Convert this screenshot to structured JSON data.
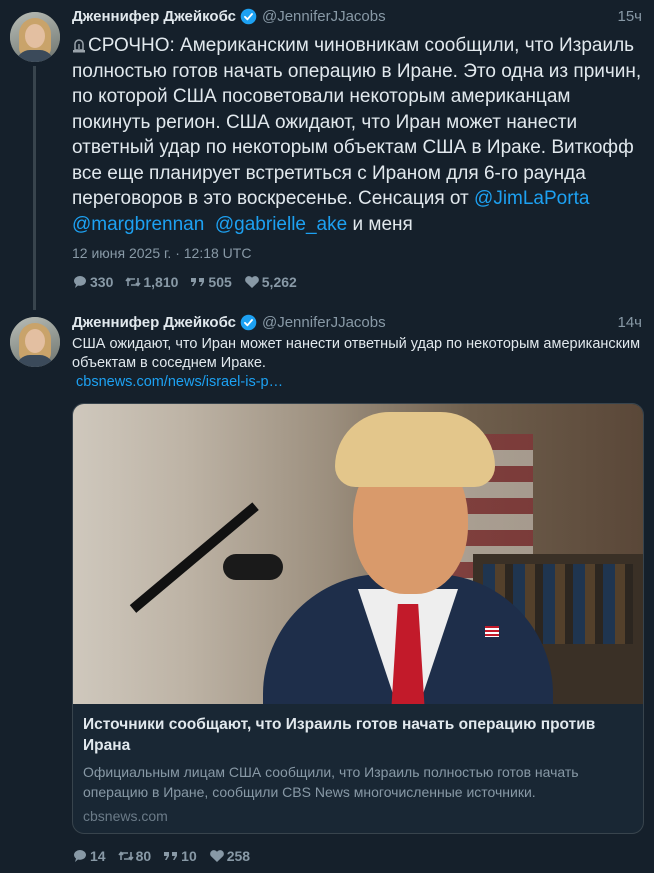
{
  "tweets": [
    {
      "author_name": "Дженнифер Джейкобс",
      "handle": "@JenniferJJacobs",
      "time": "15ч",
      "text_main": "СРОЧНО: Американским чиновникам сообщили, что Израиль полностью готов начать операцию в Иране. Это одна из причин, по которой США посоветовали некоторым американцам покинуть регион. США ожидают, что Иран может нанести ответный удар по некоторым объектам США в Ираке. Виткофф все еще планирует встретиться с Ираном для 6-го раунда переговоров в это воскресенье. Сенсация от",
      "mentions": [
        "@JimLaPorta",
        "@margbrennan",
        "@gabrielle_ake"
      ],
      "text_tail": "и меня",
      "date": "12 июня 2025 г. · 12:18 UTC",
      "stats": {
        "replies": "330",
        "retweets": "1,810",
        "quotes": "505",
        "likes": "5,262"
      }
    },
    {
      "author_name": "Дженнифер Джейкобс",
      "handle": "@JenniferJJacobs",
      "time": "14ч",
      "text_main": "США ожидают, что Иран может нанести ответный удар по некоторым американским объектам в соседнем Ираке.",
      "link": "cbsnews.com/news/israel-is-p…",
      "card": {
        "title": "Источники сообщают, что Израиль готов начать операцию против Ирана",
        "description": "Официальным лицам США сообщили, что Израиль полностью готов начать операцию в Иране, сообщили CBS News многочисленные источники.",
        "domain": "cbsnews.com"
      },
      "stats": {
        "replies": "14",
        "retweets": "80",
        "quotes": "10",
        "likes": "258"
      }
    }
  ],
  "icons": [
    "verified-badge-icon",
    "alarm-icon",
    "reply-icon",
    "retweet-icon",
    "quote-icon",
    "like-icon"
  ],
  "colors": {
    "background": "#15202b",
    "link": "#1da1f2",
    "muted": "#8899a6",
    "verified": "#1da1f2"
  }
}
